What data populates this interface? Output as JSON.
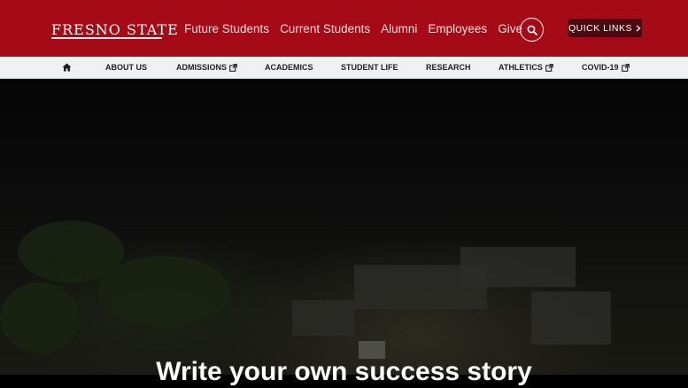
{
  "header": {
    "logo_text": "FRESNO STATE",
    "audience_links": [
      {
        "label": "Future Students"
      },
      {
        "label": "Current Students"
      },
      {
        "label": "Alumni"
      },
      {
        "label": "Employees"
      },
      {
        "label": "Give"
      }
    ],
    "search_icon": "search-icon",
    "quick_links_label": "QUICK LINKS"
  },
  "subnav": {
    "home_icon": "home-icon",
    "items": [
      {
        "label": "ABOUT US"
      },
      {
        "label": "ADMISSIONS",
        "external": true
      },
      {
        "label": "ACADEMICS"
      },
      {
        "label": "STUDENT LIFE"
      },
      {
        "label": "RESEARCH"
      },
      {
        "label": "ATHLETICS",
        "external": true
      },
      {
        "label": "COVID-19",
        "external": true
      }
    ]
  },
  "hero": {
    "headline": "Write your own success story"
  },
  "colors": {
    "brand_red": "#a50b16",
    "quick_links_bg": "#4a0a0f",
    "subnav_bg": "#eef0f2"
  }
}
